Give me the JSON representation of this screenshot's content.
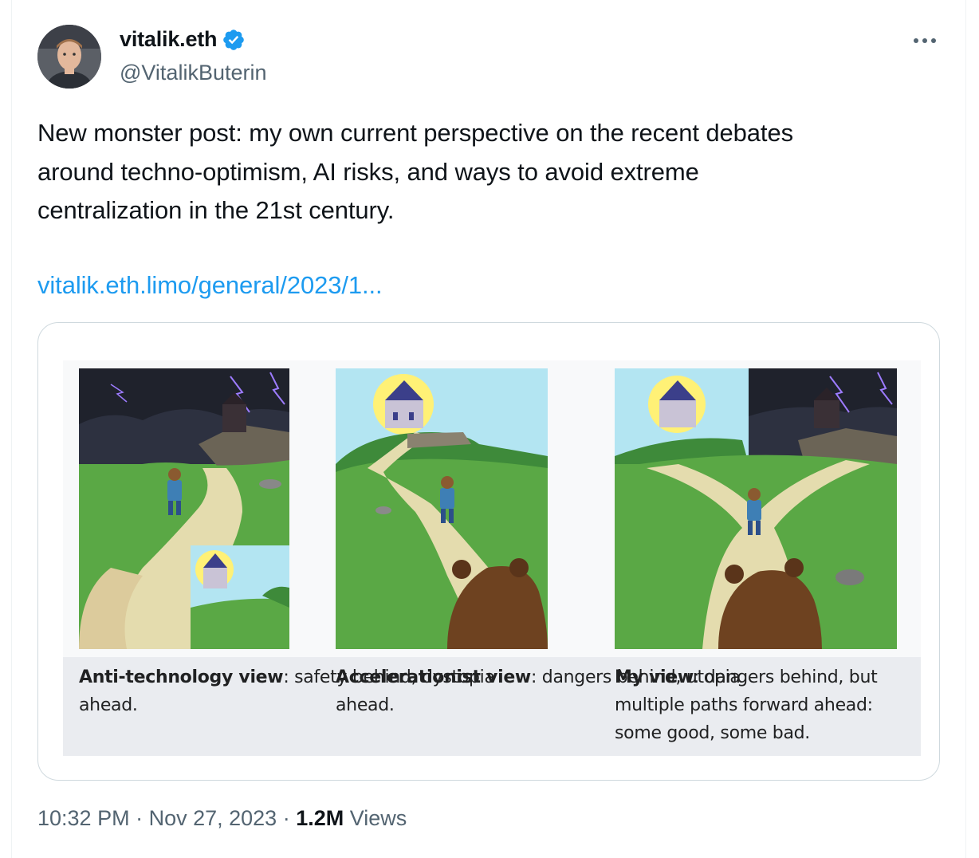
{
  "author": {
    "display_name": "vitalik.eth",
    "handle": "@VitalikButerin",
    "verified_icon": "verified-badge-icon",
    "avatar_icon": "avatar"
  },
  "more_icon": "more-options-icon",
  "tweet": {
    "line1": "New monster post: my own current perspective on the recent debates",
    "line2": "around techno-optimism, AI risks, and ways to avoid extreme",
    "line3": "centralization in the 21st century.",
    "link": "vitalik.eth.limo/general/2023/1..."
  },
  "media": {
    "panels": [
      {
        "title": "Anti-technology view",
        "colon": ":",
        "line1": " safety behind, dystopia",
        "line2": "ahead."
      },
      {
        "title": "Accelerationist view",
        "colon": ":",
        "line1": " dangers behind, utopia",
        "line2": "ahead."
      },
      {
        "title": "My view",
        "colon": ":",
        "line1": " dangers behind, but",
        "line2": "multiple paths forward ahead:",
        "line3": "some good, some bad."
      }
    ]
  },
  "meta": {
    "time": "10:32 PM",
    "sep1": " · ",
    "date": "Nov 27, 2023",
    "sep2": " · ",
    "views_count": "1.2M",
    "views_label": " Views"
  },
  "colors": {
    "link": "#1d9bf0",
    "secondary": "#536471",
    "verified": "#1d9bf0",
    "grass": "#5aa845",
    "path": "#e4dcae",
    "storm_sky": "#2d3140",
    "clear_sky": "#b3e5f2"
  }
}
